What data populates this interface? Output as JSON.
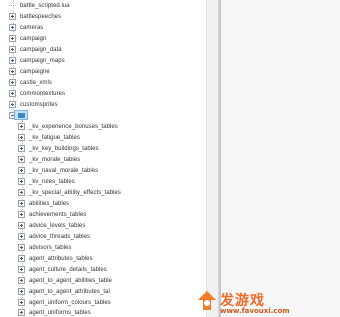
{
  "tree": {
    "top_items": [
      "battle_scripted.lua",
      "battlespeeches",
      "cameras",
      "campaign",
      "campaign_data",
      "campaign_maps",
      "campaigne",
      "castle_xmls",
      "commontextures",
      "customsprites"
    ],
    "child_items": [
      "_kv_experience_bonuses_tables",
      "_kv_fatigue_tables",
      "_kv_key_buildings_tables",
      "_kv_morale_tables",
      "_kv_naval_morale_tables",
      "_kv_rules_tables",
      "_kv_special_ability_effects_tables",
      "abilities_tables",
      "achievements_tables",
      "advice_levels_tables",
      "advice_threads_tables",
      "advisors_tables",
      "agent_attributes_tables",
      "agent_culture_details_tables",
      "agent_to_agent_abilities_table",
      "agent_to_agent_attributes_tal",
      "agent_uniform_colours_tables",
      "agent_uniforms_tables"
    ]
  },
  "watermark": {
    "title": "发游戏",
    "url": "www.favouxi.com"
  }
}
